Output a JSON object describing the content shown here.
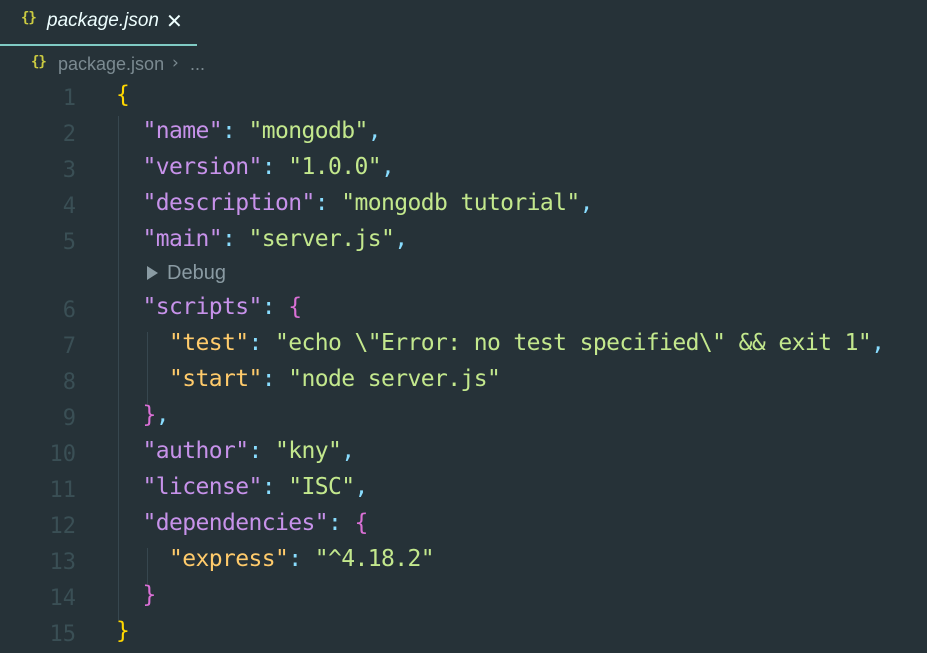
{
  "tab": {
    "icon": "json-braces-icon",
    "icon_text": "{}",
    "label": "package.json",
    "close": "✕"
  },
  "breadcrumb": {
    "icon_text": "{}",
    "file": "package.json",
    "separator": "›",
    "more": "..."
  },
  "codelens": {
    "label": "Debug"
  },
  "colors": {
    "background": "#263238",
    "key": "#c792ea",
    "nested_key": "#ffcb6b",
    "string": "#c3e88d",
    "punctuation": "#89ddff",
    "brace_outer": "#ffd700",
    "brace_inner": "#da70d6",
    "line_number": "#3a4f55",
    "tab_underline": "#80cbc4"
  },
  "lines": [
    {
      "n": "1"
    },
    {
      "n": "2",
      "key": "\"name\"",
      "value": "\"mongodb\""
    },
    {
      "n": "3",
      "key": "\"version\"",
      "value": "\"1.0.0\""
    },
    {
      "n": "4",
      "key": "\"description\"",
      "value": "\"mongodb tutorial\""
    },
    {
      "n": "5",
      "key": "\"main\"",
      "value": "\"server.js\""
    },
    {
      "n": "6",
      "key": "\"scripts\""
    },
    {
      "n": "7",
      "key": "\"test\"",
      "value": "\"echo \\\"Error: no test specified\\\" && exit 1\""
    },
    {
      "n": "8",
      "key": "\"start\"",
      "value": "\"node server.js\""
    },
    {
      "n": "9"
    },
    {
      "n": "10",
      "key": "\"author\"",
      "value": "\"kny\""
    },
    {
      "n": "11",
      "key": "\"license\"",
      "value": "\"ISC\""
    },
    {
      "n": "12",
      "key": "\"dependencies\""
    },
    {
      "n": "13",
      "key": "\"express\"",
      "value": "\"^4.18.2\""
    },
    {
      "n": "14"
    },
    {
      "n": "15"
    }
  ],
  "symbols": {
    "open_brace": "{",
    "close_brace": "}",
    "colon": ": ",
    "comma": ",",
    "close_brace_comma": "},"
  }
}
